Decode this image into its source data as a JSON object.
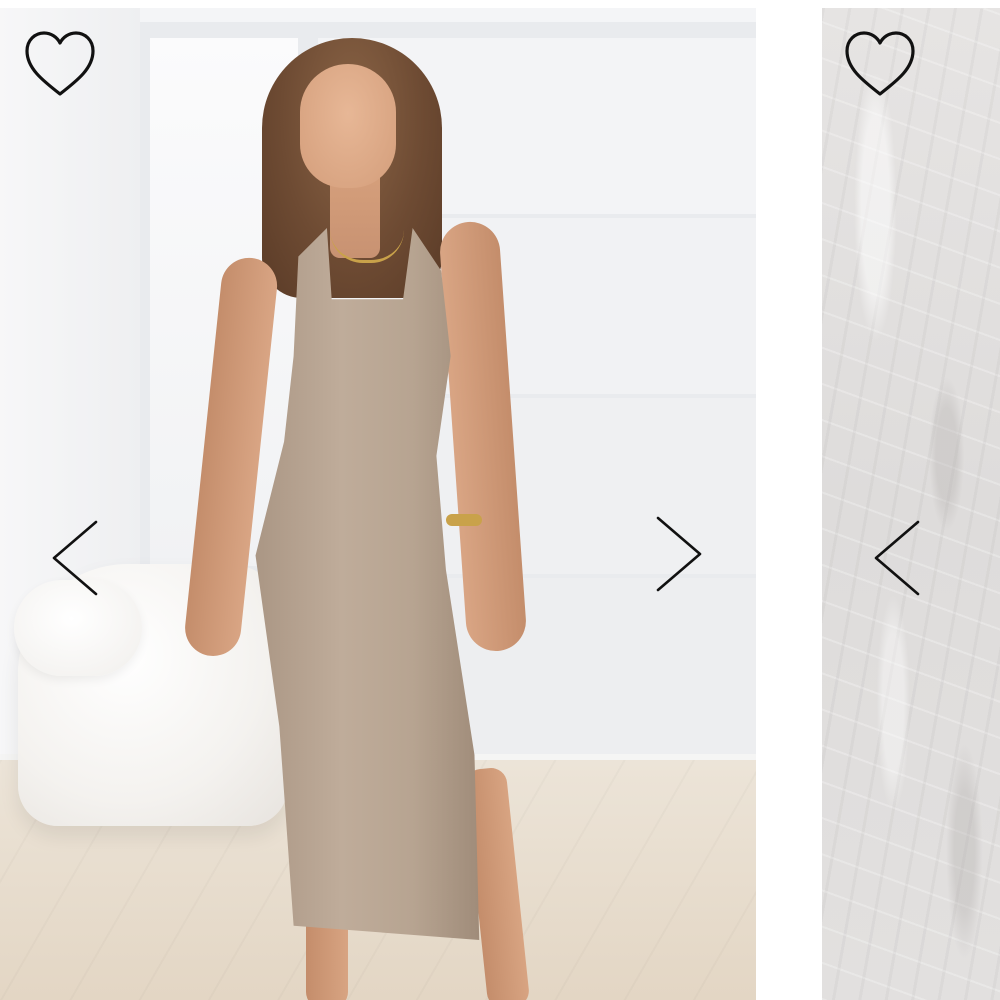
{
  "gallery": {
    "cards": [
      {
        "image_alt": "",
        "favorite_icon": "heart-outline-icon",
        "prev_icon": "chevron-left-icon",
        "next_icon": "chevron-right-icon"
      },
      {
        "image_alt": "",
        "favorite_icon": "heart-outline-icon",
        "prev_icon": "chevron-left-icon"
      }
    ]
  },
  "colors": {
    "icon_stroke": "#111111",
    "page_background": "#ffffff",
    "dress": "#b7a491",
    "texture": "#e2e0df"
  }
}
